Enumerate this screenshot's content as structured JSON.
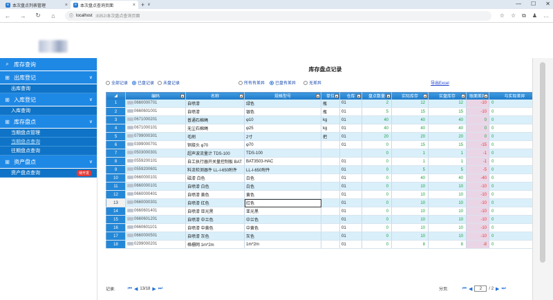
{
  "browser": {
    "tabs": [
      {
        "label": "本次盘点列表管理",
        "icon": "edge-page-icon",
        "active": false
      },
      {
        "label": "本次盘点查询页面",
        "icon": "edge-page-icon",
        "active": true
      }
    ],
    "new_tab": "+",
    "new_tab_dropdown": "∨",
    "window_controls": [
      "—",
      "☐",
      "✕"
    ],
    "url_host": "localhost",
    "url_path": ":8352/本次盘点查询页面",
    "nav_icons": [
      "←",
      "→",
      "↻",
      "⌂"
    ],
    "tool_icons": [
      "☆",
      "☆",
      "⧉",
      "♟",
      "…"
    ]
  },
  "sidebar": {
    "menus": [
      {
        "icon": "⌕",
        "label": "库存查询",
        "chevron": "",
        "subs": []
      },
      {
        "icon": "⊞",
        "label": "出库登记",
        "chevron": "∨",
        "subs": [
          {
            "label": "出库查询"
          }
        ]
      },
      {
        "icon": "⊞",
        "label": "入库登记",
        "chevron": "∨",
        "subs": [
          {
            "label": "入库查询"
          }
        ]
      },
      {
        "icon": "⊞",
        "label": "库存盘点",
        "chevron": "∨",
        "subs": [
          {
            "label": "当期盘点管理"
          },
          {
            "label": "当期盘点查询",
            "selected": true
          },
          {
            "label": "往期盘点查询"
          }
        ]
      },
      {
        "icon": "⊞",
        "label": "资产盘点",
        "chevron": "∨",
        "subs": [
          {
            "label": "资产盘点查询",
            "badge": "待开发"
          }
        ]
      }
    ]
  },
  "main": {
    "title": "库存盘点记录",
    "filters": [
      {
        "label": "全部记录",
        "on": false
      },
      {
        "label": "已盘记录",
        "on": true
      },
      {
        "label": "未盘记录",
        "on": false
      },
      {
        "label": "所有有差异",
        "on": false
      },
      {
        "label": "已盘有差异",
        "on": true
      },
      {
        "label": "无差异",
        "on": false
      }
    ],
    "export_label": "导出Excel",
    "columns": [
      "",
      "编码",
      "名称",
      "规格型号",
      "单位",
      "仓库",
      "盘点数量",
      "实际库存",
      "实盘库存",
      "账面差异",
      "与实际差异"
    ],
    "rows": [
      {
        "n": "1",
        "code": "0660000701",
        "name": "自喷漆",
        "spec": "绿色",
        "unit": "瓶",
        "wh": "01",
        "count": "2",
        "real": "12",
        "book": "12",
        "diff": "-10",
        "act": "0"
      },
      {
        "n": "2",
        "code": "0660601001",
        "name": "自喷漆",
        "spec": "银色",
        "unit": "瓶",
        "wh": "01",
        "count": "5",
        "real": "15",
        "book": "15",
        "diff": "-10",
        "act": "0"
      },
      {
        "n": "3",
        "code": "0671000201",
        "name": "普通石棉绳",
        "spec": "φ10",
        "unit": "kg",
        "wh": "01",
        "count": "40",
        "real": "40",
        "book": "40",
        "diff": "0",
        "act": "0"
      },
      {
        "n": "4",
        "code": "0671000101",
        "name": "无尘石棉绳",
        "spec": "φ25",
        "unit": "kg",
        "wh": "01",
        "count": "40",
        "real": "40",
        "book": "40",
        "diff": "0",
        "act": "0"
      },
      {
        "n": "5",
        "code": "0799000301",
        "name": "毛刷",
        "spec": "2寸",
        "unit": "把",
        "wh": "01",
        "count": "20",
        "real": "20",
        "book": "20",
        "diff": "0",
        "act": "0"
      },
      {
        "n": "6",
        "code": "0399000701",
        "name": "铜接头 φ70",
        "spec": "φ70",
        "unit": "",
        "wh": "01",
        "count": "0",
        "real": "15",
        "book": "15",
        "diff": "-15",
        "act": "0"
      },
      {
        "n": "7",
        "code": "0503000301",
        "name": "超声波流量计 TDS-100",
        "spec": "TDS-100",
        "unit": "",
        "wh": "",
        "count": "0",
        "real": "1",
        "book": "1",
        "diff": "-1",
        "act": "0"
      },
      {
        "n": "8",
        "code": "0559200101",
        "name": "自工执行器开关量控制板 BAT",
        "spec": "BAT3503-HAC",
        "unit": "",
        "wh": "01",
        "count": "0",
        "real": "1",
        "book": "1",
        "diff": "-1",
        "act": "0"
      },
      {
        "n": "9",
        "code": "0559200601",
        "name": "料流检测器件 LL-I-650附件",
        "spec": "LL-I-650附件",
        "unit": "",
        "wh": "01",
        "count": "0",
        "real": "5",
        "book": "5",
        "diff": "-5",
        "act": "0"
      },
      {
        "n": "10",
        "code": "0660000101",
        "name": "磁漆 白色",
        "spec": "白色",
        "unit": "",
        "wh": "01",
        "count": "0",
        "real": "40",
        "book": "40",
        "diff": "-40",
        "act": "0"
      },
      {
        "n": "11",
        "code": "0660000101",
        "name": "自喷漆 白色",
        "spec": "白色",
        "unit": "",
        "wh": "01",
        "count": "0",
        "real": "10",
        "book": "10",
        "diff": "-10",
        "act": "0"
      },
      {
        "n": "12",
        "code": "0660000401",
        "name": "自喷漆 黄色",
        "spec": "黄色",
        "unit": "",
        "wh": "01",
        "count": "0",
        "real": "10",
        "book": "10",
        "diff": "-10",
        "act": "0"
      },
      {
        "n": "13",
        "code": "0660000301",
        "name": "自喷漆 红色",
        "spec": "红色",
        "unit": "",
        "wh": "01",
        "count": "0",
        "real": "10",
        "book": "10",
        "diff": "-10",
        "act": "0",
        "selected": true
      },
      {
        "n": "14",
        "code": "0660601401",
        "name": "自喷漆 亚光黑",
        "spec": "亚光黑",
        "unit": "",
        "wh": "01",
        "count": "0",
        "real": "10",
        "book": "10",
        "diff": "-10",
        "act": "0"
      },
      {
        "n": "15",
        "code": "0660601201",
        "name": "自喷漆 中兰色",
        "spec": "中兰色",
        "unit": "",
        "wh": "01",
        "count": "0",
        "real": "10",
        "book": "10",
        "diff": "-10",
        "act": "0"
      },
      {
        "n": "16",
        "code": "0660601101",
        "name": "自喷漆 中黄色",
        "spec": "中黄色",
        "unit": "",
        "wh": "01",
        "count": "0",
        "real": "10",
        "book": "10",
        "diff": "-10",
        "act": "0"
      },
      {
        "n": "17",
        "code": "0660000501",
        "name": "自喷漆 灰色",
        "spec": "灰色",
        "unit": "",
        "wh": "01",
        "count": "0",
        "real": "10",
        "book": "10",
        "diff": "-10",
        "act": "0"
      },
      {
        "n": "18",
        "code": "0299000201",
        "name": "格栅网 1m*2m",
        "spec": "1m*2m",
        "unit": "",
        "wh": "01",
        "count": "0",
        "real": "8",
        "book": "8",
        "diff": "-8",
        "act": "0"
      }
    ],
    "footer": {
      "records_label": "记录:",
      "records_value": "13/18",
      "pages_label": "分页:",
      "page_current": "2",
      "page_total": "/ 2"
    }
  },
  "colors": {
    "sidebar_blue": "#1e88e5",
    "sidebar_sub": "#0f74c7",
    "grid_header": "#1d78c8",
    "row_alt": "#d9f0fb",
    "diff_bg": "#ead5e6",
    "green": "#1b9f3b",
    "red": "#e53935"
  }
}
